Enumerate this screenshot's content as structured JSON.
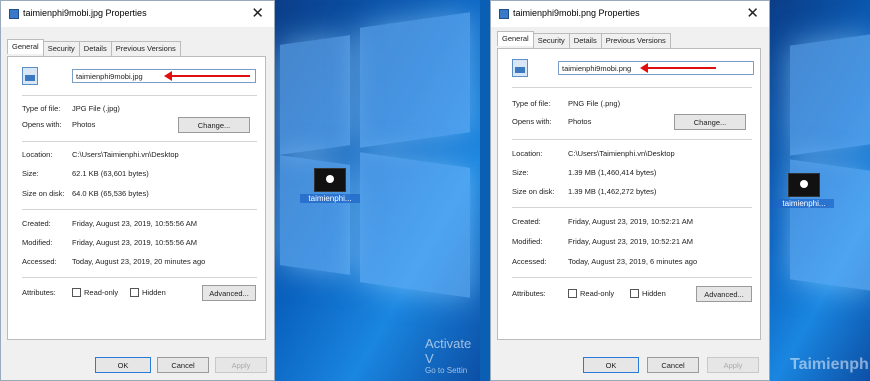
{
  "left_dialog": {
    "title": "taimienphi9mobi.jpg Properties",
    "close": "✕",
    "tabs": [
      "General",
      "Security",
      "Details",
      "Previous Versions"
    ],
    "filename": "taimienphi9mobi.jpg",
    "type_label": "Type of file:",
    "type_value": "JPG File (.jpg)",
    "opens_label": "Opens with:",
    "opens_value": "Photos",
    "change_btn": "Change...",
    "location_label": "Location:",
    "location_value": "C:\\Users\\Taimienphi.vn\\Desktop",
    "size_label": "Size:",
    "size_value": "62.1 KB (63,601 bytes)",
    "sizeondisk_label": "Size on disk:",
    "sizeondisk_value": "64.0 KB (65,536 bytes)",
    "created_label": "Created:",
    "created_value": "Friday, August 23, 2019, 10:55:56 AM",
    "modified_label": "Modified:",
    "modified_value": "Friday, August 23, 2019, 10:55:56 AM",
    "accessed_label": "Accessed:",
    "accessed_value": "Today, August 23, 2019, 20 minutes ago",
    "attributes_label": "Attributes:",
    "readonly": "Read-only",
    "hidden": "Hidden",
    "advanced_btn": "Advanced...",
    "ok": "OK",
    "cancel": "Cancel",
    "apply": "Apply"
  },
  "right_dialog": {
    "title": "taimienphi9mobi.png Properties",
    "close": "✕",
    "tabs": [
      "General",
      "Security",
      "Details",
      "Previous Versions"
    ],
    "filename": "taimienphi9mobi.png",
    "type_label": "Type of file:",
    "type_value": "PNG File (.png)",
    "opens_label": "Opens with:",
    "opens_value": "Photos",
    "change_btn": "Change...",
    "location_label": "Location:",
    "location_value": "C:\\Users\\Taimienphi.vn\\Desktop",
    "size_label": "Size:",
    "size_value": "1.39 MB (1,460,414 bytes)",
    "sizeondisk_label": "Size on disk:",
    "sizeondisk_value": "1.39 MB (1,462,272 bytes)",
    "created_label": "Created:",
    "created_value": "Friday, August 23, 2019, 10:52:21 AM",
    "modified_label": "Modified:",
    "modified_value": "Friday, August 23, 2019, 10:52:21 AM",
    "accessed_label": "Accessed:",
    "accessed_value": "Today, August 23, 2019, 6 minutes ago",
    "attributes_label": "Attributes:",
    "readonly": "Read-only",
    "hidden": "Hidden",
    "advanced_btn": "Advanced...",
    "ok": "OK",
    "cancel": "Cancel",
    "apply": "Apply"
  },
  "desktop": {
    "icon_left_label": "taimienphi...",
    "icon_right_label": "taimienphi...",
    "activate_title": "Activate V",
    "activate_sub": "Go to Settin",
    "watermark": "Taimienphi"
  },
  "colors": {
    "arrow": "#e01010",
    "desktop": "#0a63c0"
  }
}
